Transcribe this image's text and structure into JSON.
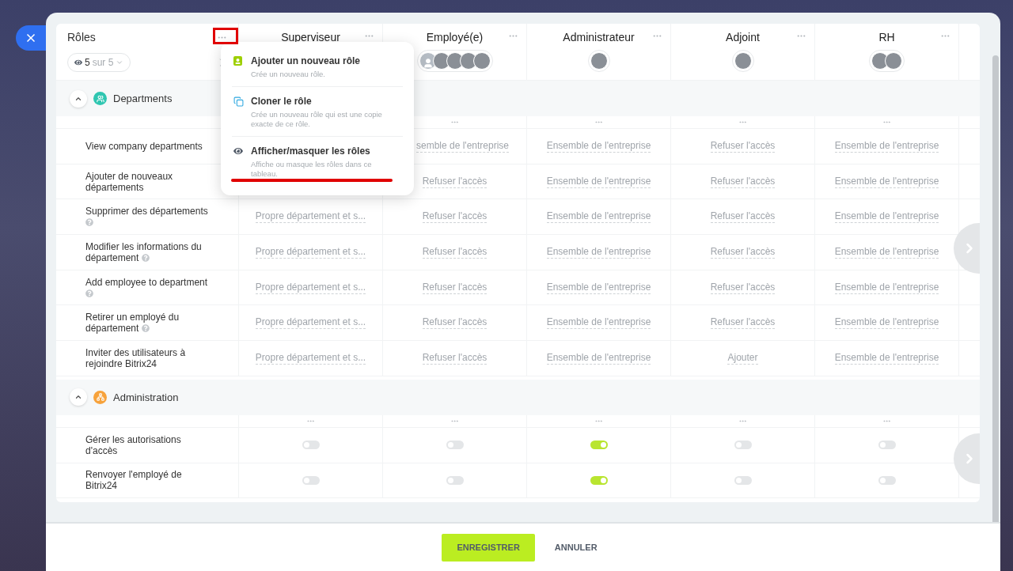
{
  "roles_header": {
    "title": "Rôles",
    "filter": {
      "count": "5",
      "total": "sur 5"
    }
  },
  "roles": [
    {
      "name": "Superviseur"
    },
    {
      "name": "Employé(e)",
      "avatars": [
        {
          "kind": "generic"
        },
        {
          "kind": "photo"
        },
        {
          "kind": "photo"
        },
        {
          "kind": "photo"
        },
        {
          "kind": "photo"
        }
      ]
    },
    {
      "name": "Administrateur",
      "avatars": [
        {
          "kind": "photo"
        }
      ]
    },
    {
      "name": "Adjoint",
      "avatars": [
        {
          "kind": "photo"
        }
      ]
    },
    {
      "name": "RH",
      "avatars": [
        {
          "kind": "photo"
        },
        {
          "kind": "photo"
        }
      ]
    }
  ],
  "sections": [
    {
      "title": "Departments",
      "kind": "team",
      "color": "#2fc6b1",
      "expanded": true,
      "rows": [
        {
          "label": "View company departments",
          "help": false,
          "cells": [
            null,
            {
              "kind": "partial",
              "text": "semble de l'entreprise"
            },
            {
              "kind": "link",
              "text": "Ensemble de l'entreprise"
            },
            {
              "kind": "link",
              "text": "Refuser l'accès"
            },
            {
              "kind": "link",
              "text": "Ensemble de l'entreprise"
            }
          ]
        },
        {
          "label": "Ajouter de nouveaux départements",
          "help": false,
          "cells": [
            null,
            {
              "kind": "link",
              "text": "Refuser l'accès"
            },
            {
              "kind": "link",
              "text": "Ensemble de l'entreprise"
            },
            {
              "kind": "link",
              "text": "Refuser l'accès"
            },
            {
              "kind": "link",
              "text": "Ensemble de l'entreprise"
            }
          ]
        },
        {
          "label": "Supprimer des départements",
          "help": true,
          "cells": [
            {
              "kind": "link",
              "text": "Propre département et s..."
            },
            {
              "kind": "link",
              "text": "Refuser l'accès"
            },
            {
              "kind": "link",
              "text": "Ensemble de l'entreprise"
            },
            {
              "kind": "link",
              "text": "Refuser l'accès"
            },
            {
              "kind": "link",
              "text": "Ensemble de l'entreprise"
            }
          ]
        },
        {
          "label": "Modifier les informations du département",
          "help": true,
          "cells": [
            {
              "kind": "link",
              "text": "Propre département et s..."
            },
            {
              "kind": "link",
              "text": "Refuser l'accès"
            },
            {
              "kind": "link",
              "text": "Ensemble de l'entreprise"
            },
            {
              "kind": "link",
              "text": "Refuser l'accès"
            },
            {
              "kind": "link",
              "text": "Ensemble de l'entreprise"
            }
          ]
        },
        {
          "label": "Add employee to department",
          "help": true,
          "cells": [
            {
              "kind": "link",
              "text": "Propre département et s..."
            },
            {
              "kind": "link",
              "text": "Refuser l'accès"
            },
            {
              "kind": "link",
              "text": "Ensemble de l'entreprise"
            },
            {
              "kind": "link",
              "text": "Refuser l'accès"
            },
            {
              "kind": "link",
              "text": "Ensemble de l'entreprise"
            }
          ]
        },
        {
          "label": "Retirer un employé du département",
          "help": true,
          "cells": [
            {
              "kind": "link",
              "text": "Propre département et s..."
            },
            {
              "kind": "link",
              "text": "Refuser l'accès"
            },
            {
              "kind": "link",
              "text": "Ensemble de l'entreprise"
            },
            {
              "kind": "link",
              "text": "Refuser l'accès"
            },
            {
              "kind": "link",
              "text": "Ensemble de l'entreprise"
            }
          ]
        },
        {
          "label": "Inviter des utilisateurs à rejoindre Bitrix24",
          "help": false,
          "cells": [
            {
              "kind": "link",
              "text": "Propre département et s..."
            },
            {
              "kind": "link",
              "text": "Refuser l'accès"
            },
            {
              "kind": "link",
              "text": "Ensemble de l'entreprise"
            },
            {
              "kind": "link",
              "text": "Ajouter"
            },
            {
              "kind": "link",
              "text": "Ensemble de l'entreprise"
            }
          ]
        }
      ]
    },
    {
      "title": "Administration",
      "kind": "admin",
      "color": "#f7a23b",
      "expanded": true,
      "rows": [
        {
          "label": "Gérer les autorisations d'accès",
          "help": false,
          "cells": [
            {
              "kind": "toggle",
              "on": false
            },
            {
              "kind": "toggle",
              "on": false
            },
            {
              "kind": "toggle",
              "on": true
            },
            {
              "kind": "toggle",
              "on": false
            },
            {
              "kind": "toggle",
              "on": false
            }
          ]
        },
        {
          "label": "Renvoyer l'employé de Bitrix24",
          "help": false,
          "cells": [
            {
              "kind": "toggle",
              "on": false
            },
            {
              "kind": "toggle",
              "on": false
            },
            {
              "kind": "toggle",
              "on": true
            },
            {
              "kind": "toggle",
              "on": false
            },
            {
              "kind": "toggle",
              "on": false
            }
          ]
        }
      ]
    }
  ],
  "menu": [
    {
      "kind": "add",
      "title": "Ajouter un nouveau rôle",
      "description": "Crée un nouveau rôle."
    },
    {
      "kind": "clone",
      "title": "Cloner le rôle",
      "description": "Crée un nouveau rôle qui est une copie exacte de ce rôle."
    },
    {
      "kind": "visibility",
      "title": "Afficher/masquer les rôles",
      "description": "Affiche ou masque les rôles dans ce tableau."
    }
  ],
  "footer": {
    "buttons": [
      {
        "label": "ENREGISTRER",
        "kind": "primary"
      },
      {
        "label": "ANNULER",
        "kind": "plain"
      }
    ]
  }
}
